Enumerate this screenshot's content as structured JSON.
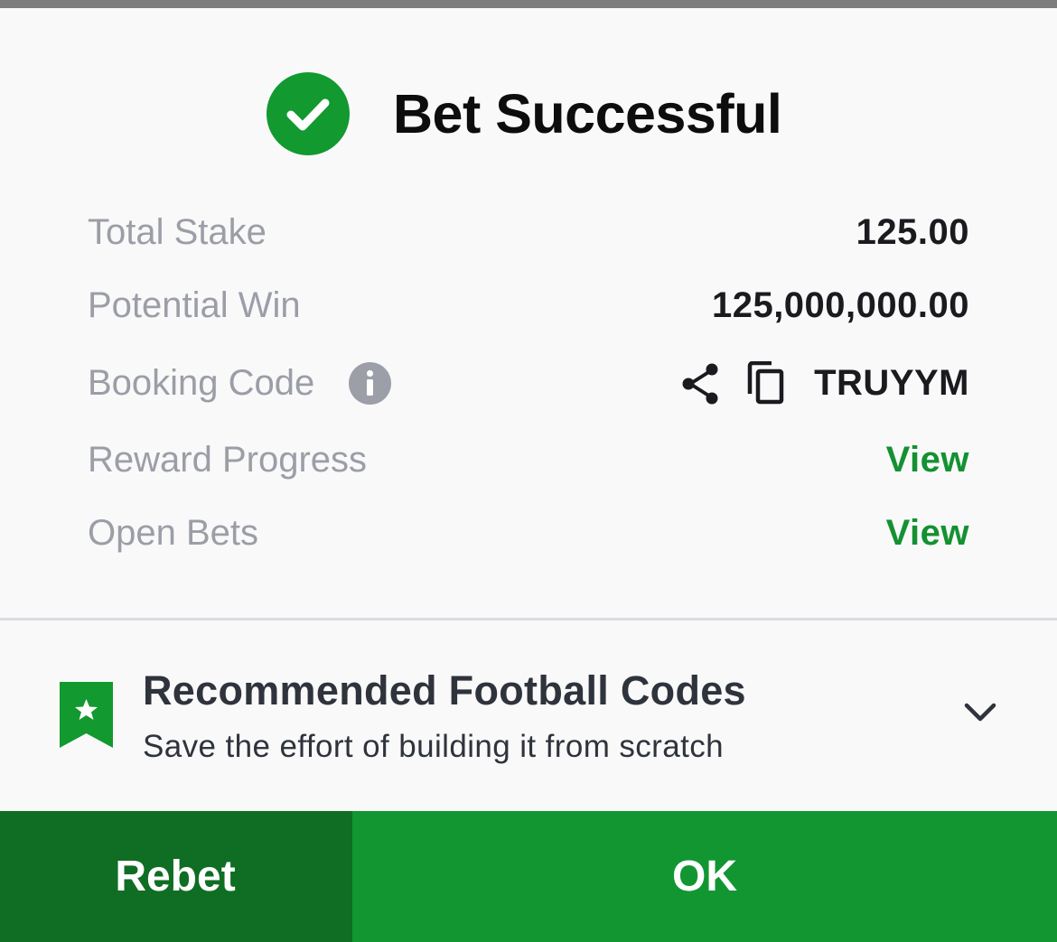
{
  "header": {
    "title": "Bet Successful",
    "icon": "check-circle-icon",
    "icon_color": "#12992f"
  },
  "summary": {
    "total_stake_label": "Total Stake",
    "total_stake_value": "125.00",
    "potential_win_label": "Potential Win",
    "potential_win_value": "125,000,000.00",
    "booking_code_label": "Booking Code",
    "booking_code_value": "TRUYYM",
    "booking_code_icons": [
      "info-icon",
      "share-icon",
      "copy-icon"
    ],
    "reward_progress_label": "Reward Progress",
    "reward_progress_link": "View",
    "open_bets_label": "Open Bets",
    "open_bets_link": "View",
    "link_color": "#149131"
  },
  "recommended": {
    "title": "Recommended Football Codes",
    "subtitle": "Save the effort of building it from scratch",
    "icon": "bookmark-star-icon",
    "expand_icon": "chevron-down-icon"
  },
  "actions": {
    "rebet_label": "Rebet",
    "ok_label": "OK",
    "rebet_color": "#0f6e23",
    "ok_color": "#129632"
  }
}
